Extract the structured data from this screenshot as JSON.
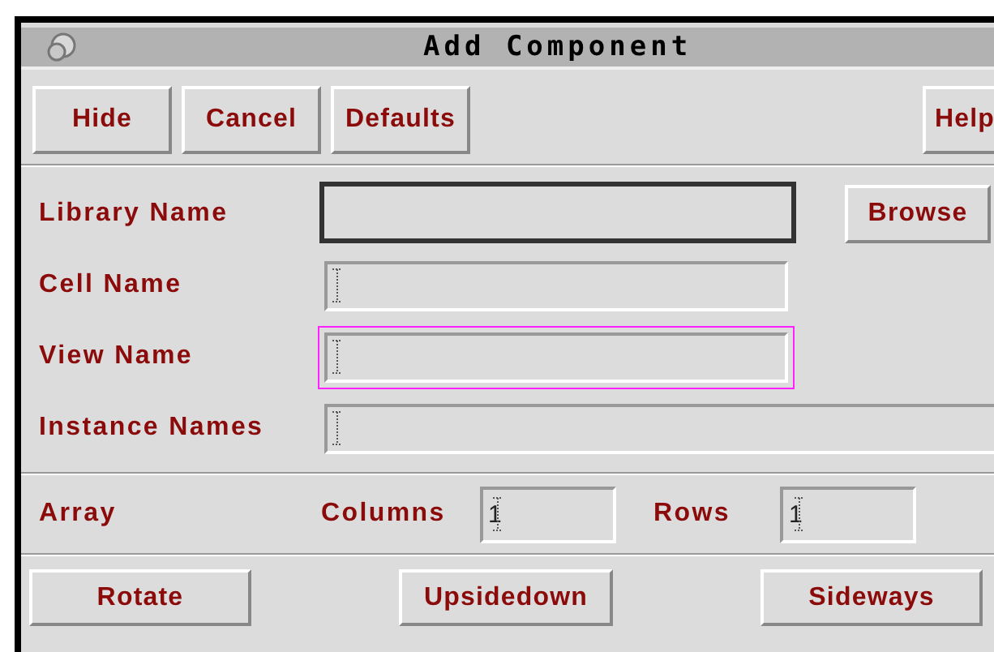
{
  "window": {
    "title": "Add Component"
  },
  "top_buttons": [
    "Hide",
    "Cancel",
    "Defaults",
    "Help"
  ],
  "fields": [
    {
      "label": "Library Name",
      "focused": true,
      "highlighted": false,
      "button": "Browse"
    },
    {
      "label": "Cell Name",
      "focused": false,
      "highlighted": false
    },
    {
      "label": "View Name",
      "focused": false,
      "highlighted": true
    },
    {
      "label": "Instance Names",
      "focused": false,
      "highlighted": false
    }
  ],
  "array": {
    "label": "Array",
    "columns": {
      "label": "Columns",
      "value": "1"
    },
    "rows": {
      "label": "Rows",
      "value": "1"
    }
  },
  "bottom_buttons": [
    "Rotate",
    "Upsidedown",
    "Sideways"
  ]
}
